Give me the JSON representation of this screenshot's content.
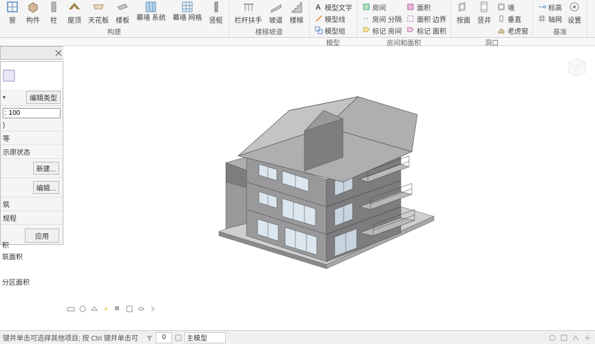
{
  "ribbon": {
    "groups": [
      {
        "label": "构建",
        "items": [
          {
            "label": "窗",
            "icon": "window"
          },
          {
            "label": "构件",
            "icon": "component"
          },
          {
            "label": "柱",
            "icon": "column"
          },
          {
            "label": "屋顶",
            "icon": "roof",
            "dd": true
          },
          {
            "label": "天花板",
            "icon": "ceiling"
          },
          {
            "label": "楼板",
            "icon": "floor",
            "dd": true
          },
          {
            "label": "幕墙\n系统",
            "icon": "curtain-sys"
          },
          {
            "label": "幕墙\n网格",
            "icon": "curtain-grid"
          },
          {
            "label": "竖梃",
            "icon": "mullion"
          }
        ]
      },
      {
        "label": "楼梯坡道",
        "items": [
          {
            "label": "栏杆扶手",
            "icon": "railing",
            "dd": true
          },
          {
            "label": "坡道",
            "icon": "ramp"
          },
          {
            "label": "楼梯",
            "icon": "stair"
          }
        ]
      },
      {
        "label": "模型",
        "items": [
          {
            "label": "模型文字",
            "icon": "text",
            "sm": true
          },
          {
            "label": "模型线",
            "icon": "line",
            "sm": true
          },
          {
            "label": "模型组",
            "icon": "group",
            "sm": true,
            "dd": true
          }
        ]
      },
      {
        "label": "房间和面积",
        "items_col1": [
          {
            "label": "房间",
            "icon": "room",
            "sm": true
          },
          {
            "label": "房间 分隔",
            "icon": "sep",
            "sm": true
          },
          {
            "label": "标记 房间",
            "icon": "tag",
            "sm": true,
            "dd": true
          }
        ],
        "items_col2": [
          {
            "label": "面积",
            "icon": "area",
            "sm": true,
            "dd": true
          },
          {
            "label": "面积 边界",
            "icon": "bound",
            "sm": true
          },
          {
            "label": "标记 面积",
            "icon": "tag2",
            "sm": true,
            "dd": true
          }
        ]
      },
      {
        "label": "洞口",
        "items": [
          {
            "label": "按面",
            "icon": "byface"
          },
          {
            "label": "竖井",
            "icon": "shaft"
          },
          {
            "label": "墙",
            "icon": "wall-op",
            "sm": true
          },
          {
            "label": "垂直",
            "icon": "vert",
            "sm": true
          },
          {
            "label": "老虎窗",
            "icon": "dormer",
            "sm": true
          }
        ]
      },
      {
        "label": "基准",
        "items": [
          {
            "label": "标高",
            "icon": "level",
            "sm": true
          },
          {
            "label": "轴网",
            "icon": "grid",
            "sm": true
          },
          {
            "label": "设置",
            "icon": "set"
          }
        ]
      }
    ]
  },
  "panel": {
    "edit_type": "编辑类型",
    "scale_value": ": 100",
    "orig": "示原状态",
    "btn_new": "新建...",
    "btn_edit": "编辑...",
    "r1": "筑",
    "r2": "规程",
    "apply": "应用",
    "list": [
      "积",
      "筑面积",
      "分区面积"
    ]
  },
  "status": {
    "hint": "键并单击可选择其他项目; 按 Ctrl 键并单击可",
    "num": "0",
    "dd": "主模型"
  },
  "viewcube": {
    "face": ""
  }
}
